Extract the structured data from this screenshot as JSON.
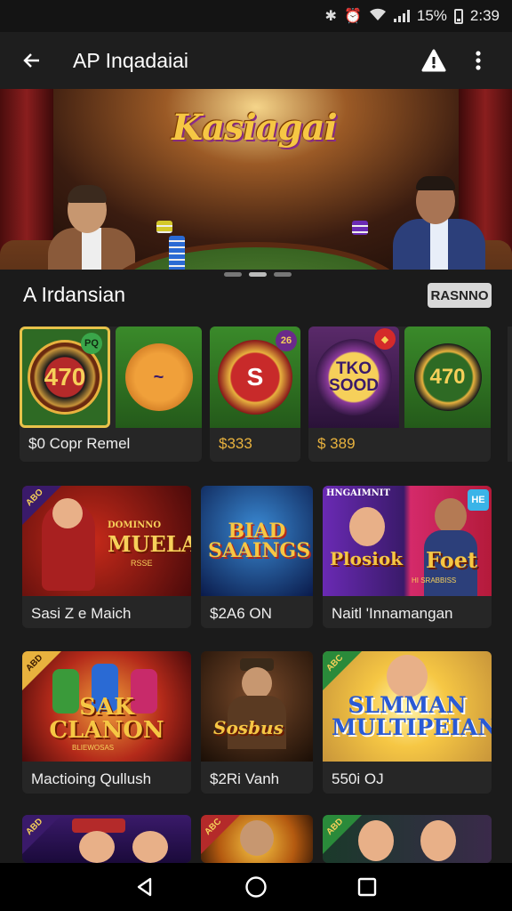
{
  "status_bar": {
    "battery": "15%",
    "time": "2:39",
    "icons": [
      "bluetooth-icon",
      "alarm-icon",
      "wifi-icon",
      "signal-icon",
      "battery-icon"
    ]
  },
  "app_bar": {
    "title": "AP Inqadaiai",
    "back_icon": "arrow-left-icon",
    "action_icons": [
      "alert-icon",
      "more-vert-icon"
    ]
  },
  "banner": {
    "title": "Kasiagai",
    "page_count": 3,
    "active_page": 1
  },
  "section": {
    "title": "A Irdansian",
    "badge": "RASNNO"
  },
  "chip_row": [
    {
      "art": "470",
      "tag": "PQ",
      "tag_color": "#3aa64a"
    },
    {
      "art": "~"
    },
    {
      "art": "S",
      "tag": "26",
      "tag_color": "#6a2a8a"
    },
    {
      "art": "TKO SOOD",
      "tag": "◆",
      "tag_color": "#d42a2a"
    },
    {
      "art": "470"
    }
  ],
  "chip_labels": {
    "first": "$0 Copr Remel",
    "second": "$333",
    "third": "$ 389"
  },
  "games": [
    {
      "label": "Sasi Z e Maich",
      "art_title": "MUELARN",
      "art_small": "DOMINNO",
      "art_sub": "RSSE",
      "corner": "ABO"
    },
    {
      "label": "$2A6 ON",
      "art_title": "BIAD SAAINGS"
    },
    {
      "label": "Naitl 'Innamangan",
      "art_title": "Plosiok",
      "art_title2": "Foet",
      "art_small": "HNGAIMNIT",
      "art_sub": "HI SRABBISS",
      "tag": "HE"
    },
    {
      "label": "Mactioing Qullush",
      "art_title": "SAK CLANON",
      "art_sub": "BLIEWOSAS",
      "corner": "ABD"
    },
    {
      "label": "$2Ri Vanh",
      "art_title": "Sosbus"
    },
    {
      "label": "550i OJ",
      "art_title": "SLMMAN MULTIPEIAN",
      "corner": "ABC"
    },
    {
      "corner": "ABD"
    },
    {
      "corner": "ABC"
    },
    {
      "corner": "ABD"
    }
  ],
  "nav": [
    "back-triangle-icon",
    "home-circle-icon",
    "recents-square-icon"
  ]
}
